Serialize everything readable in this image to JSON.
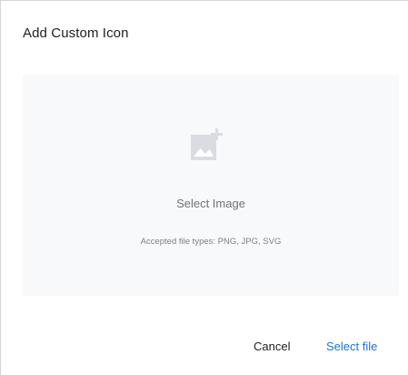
{
  "dialog": {
    "title": "Add Custom Icon"
  },
  "dropzone": {
    "icon": "add-photo-icon",
    "label": "Select Image",
    "hint": "Accepted file types: PNG, JPG, SVG"
  },
  "actions": {
    "cancel_label": "Cancel",
    "select_file_label": "Select file"
  },
  "colors": {
    "accent": "#1a73e8",
    "dropzone_bg": "#f8f9fb",
    "icon": "#d9dce1"
  }
}
